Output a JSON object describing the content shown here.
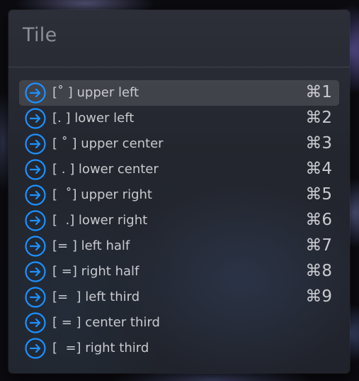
{
  "search": {
    "value": "Tile"
  },
  "colors": {
    "accent": "#1e90ff",
    "text": "#c9cacf",
    "placeholder": "#8d8f97"
  },
  "results": [
    {
      "label": "[˚ ] upper left",
      "shortcut": "⌘1",
      "icon": "arrow-right-circle-icon",
      "selected": true
    },
    {
      "label": "[. ] lower left",
      "shortcut": "⌘2",
      "icon": "arrow-right-circle-icon"
    },
    {
      "label": "[ ˚ ] upper center",
      "shortcut": "⌘3",
      "icon": "arrow-right-circle-icon"
    },
    {
      "label": "[ . ] lower center",
      "shortcut": "⌘4",
      "icon": "arrow-right-circle-icon"
    },
    {
      "label": "[  ˚] upper right",
      "shortcut": "⌘5",
      "icon": "arrow-right-circle-icon"
    },
    {
      "label": "[  .] lower right",
      "shortcut": "⌘6",
      "icon": "arrow-right-circle-icon"
    },
    {
      "label": "[= ] left half",
      "shortcut": "⌘7",
      "icon": "arrow-right-circle-icon"
    },
    {
      "label": "[ =] right half",
      "shortcut": "⌘8",
      "icon": "arrow-right-circle-icon"
    },
    {
      "label": "[=  ] left third",
      "shortcut": "⌘9",
      "icon": "arrow-right-circle-icon"
    },
    {
      "label": "[ = ] center third",
      "shortcut": "",
      "icon": "arrow-right-circle-icon"
    },
    {
      "label": "[  =] right third",
      "shortcut": "",
      "icon": "arrow-right-circle-icon"
    }
  ]
}
